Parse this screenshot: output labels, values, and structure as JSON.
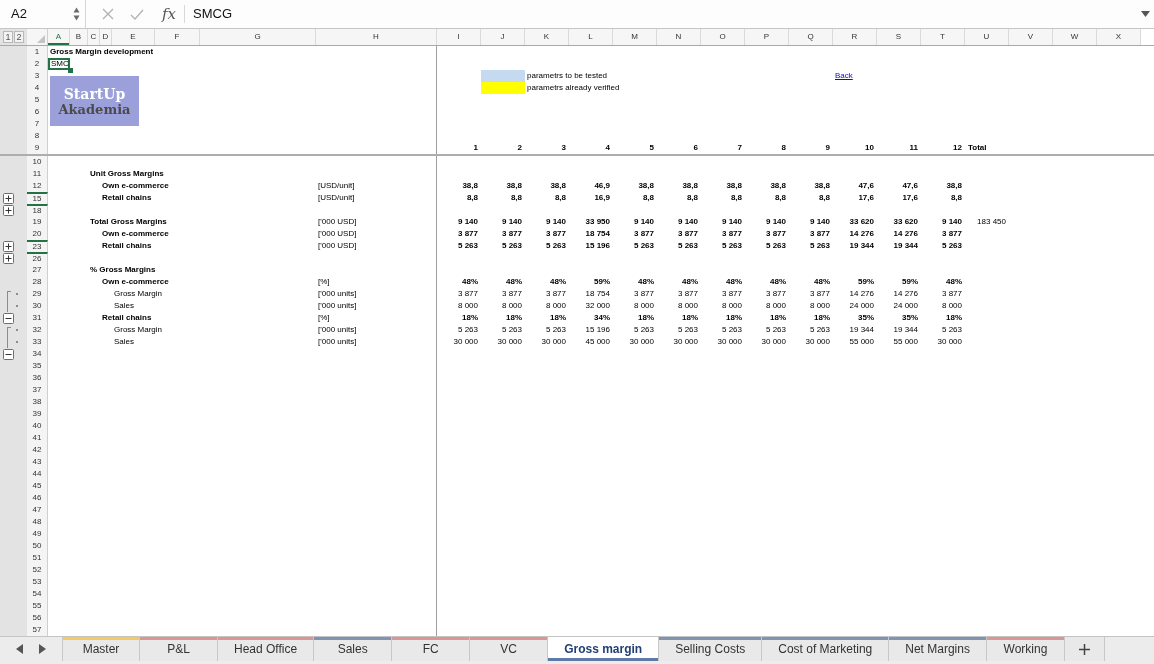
{
  "formula_bar": {
    "name_box": "A2",
    "function_label": "fx",
    "formula": "SMCG"
  },
  "outline_levels": [
    "1",
    "2"
  ],
  "columns": [
    {
      "letter": "A",
      "selected": true
    },
    {
      "letter": "B",
      "selected": false
    },
    {
      "letter": "C",
      "selected": false
    },
    {
      "letter": "D",
      "selected": false
    },
    {
      "letter": "E",
      "selected": false
    },
    {
      "letter": "F",
      "selected": false
    },
    {
      "letter": "G",
      "selected": false
    },
    {
      "letter": "H",
      "selected": false
    },
    {
      "letter": "I",
      "selected": false
    },
    {
      "letter": "J",
      "selected": false
    },
    {
      "letter": "K",
      "selected": false
    },
    {
      "letter": "L",
      "selected": false
    },
    {
      "letter": "M",
      "selected": false
    },
    {
      "letter": "N",
      "selected": false
    },
    {
      "letter": "O",
      "selected": false
    },
    {
      "letter": "P",
      "selected": false
    },
    {
      "letter": "Q",
      "selected": false
    },
    {
      "letter": "R",
      "selected": false
    },
    {
      "letter": "S",
      "selected": false
    },
    {
      "letter": "T",
      "selected": false
    },
    {
      "letter": "U",
      "selected": false
    },
    {
      "letter": "V",
      "selected": false
    },
    {
      "letter": "W",
      "selected": false
    },
    {
      "letter": "X",
      "selected": false
    }
  ],
  "logo": {
    "title": "StartUp",
    "subtitle": "Akademia"
  },
  "frozen_rows": [
    {
      "number": "1",
      "label": {
        "kind": "title",
        "text": "Gross Margin development",
        "selected": false
      }
    },
    {
      "number": "2",
      "label": {
        "kind": "plain",
        "text": "SMC",
        "selected": true
      }
    },
    {
      "number": "3",
      "legend": {
        "color": "#c5d9f1",
        "text": "parametrs to be tested"
      },
      "link": "Back"
    },
    {
      "number": "4",
      "legend": {
        "color": "#ffff00",
        "text": "parametrs already verified"
      }
    },
    {
      "number": "5"
    },
    {
      "number": "6"
    },
    {
      "number": "7"
    },
    {
      "number": "8"
    },
    {
      "number": "9",
      "header": true,
      "values": [
        "1",
        "2",
        "3",
        "4",
        "5",
        "6",
        "7",
        "8",
        "9",
        "10",
        "11",
        "12"
      ],
      "total": "Total"
    }
  ],
  "rows": [
    {
      "number": "10"
    },
    {
      "number": "11",
      "label": {
        "kind": "section",
        "text": "Unit Gross Margins",
        "selected": false
      }
    },
    {
      "number": "12",
      "label": {
        "kind": "group",
        "text": "Own e-commerce",
        "selected": false
      },
      "unit": "[USD/unit]",
      "values": [
        "38,8",
        "38,8",
        "38,8",
        "46,9",
        "38,8",
        "38,8",
        "38,8",
        "38,8",
        "38,8",
        "47,6",
        "47,6",
        "38,8"
      ]
    },
    {
      "number": "15",
      "outline": {
        "kind": "toggle",
        "expanded": false
      },
      "label": {
        "kind": "group",
        "text": "Retail chains",
        "selected": false
      },
      "unit": "[USD/unit]",
      "values": [
        "8,8",
        "8,8",
        "8,8",
        "16,9",
        "8,8",
        "8,8",
        "8,8",
        "8,8",
        "8,8",
        "17,6",
        "17,6",
        "8,8"
      ]
    },
    {
      "number": "18",
      "outline": {
        "kind": "toggle",
        "expanded": false
      }
    },
    {
      "number": "19",
      "label": {
        "kind": "section",
        "text": "Total Gross Margins",
        "selected": false
      },
      "unit": "['000 USD]",
      "values": [
        "9 140",
        "9 140",
        "9 140",
        "33 950",
        "9 140",
        "9 140",
        "9 140",
        "9 140",
        "9 140",
        "33 620",
        "33 620",
        "9 140"
      ],
      "total": "183 450"
    },
    {
      "number": "20",
      "label": {
        "kind": "group",
        "text": "Own e-commerce",
        "selected": false
      },
      "unit": "['000 USD]",
      "values": [
        "3 877",
        "3 877",
        "3 877",
        "18 754",
        "3 877",
        "3 877",
        "3 877",
        "3 877",
        "3 877",
        "14 276",
        "14 276",
        "3 877"
      ]
    },
    {
      "number": "23",
      "outline": {
        "kind": "toggle",
        "expanded": false
      },
      "label": {
        "kind": "group",
        "text": "Retail chains",
        "selected": false
      },
      "unit": "['000 USD]",
      "values": [
        "5 263",
        "5 263",
        "5 263",
        "15 196",
        "5 263",
        "5 263",
        "5 263",
        "5 263",
        "5 263",
        "19 344",
        "19 344",
        "5 263"
      ]
    },
    {
      "number": "26",
      "outline": {
        "kind": "toggle",
        "expanded": false
      }
    },
    {
      "number": "27",
      "label": {
        "kind": "section",
        "text": "% Gross Margins",
        "selected": false
      }
    },
    {
      "number": "28",
      "label": {
        "kind": "group",
        "text": "Own e-commerce",
        "selected": false
      },
      "unit": "[%]",
      "values": [
        "48%",
        "48%",
        "48%",
        "59%",
        "48%",
        "48%",
        "48%",
        "48%",
        "48%",
        "59%",
        "59%",
        "48%"
      ]
    },
    {
      "number": "29",
      "outline": {
        "kind": "member"
      },
      "label": {
        "kind": "detail",
        "text": "Gross Margin",
        "selected": false
      },
      "unit": "['000 units]",
      "values": [
        "3 877",
        "3 877",
        "3 877",
        "18 754",
        "3 877",
        "3 877",
        "3 877",
        "3 877",
        "3 877",
        "14 276",
        "14 276",
        "3 877"
      ]
    },
    {
      "number": "30",
      "outline": {
        "kind": "member"
      },
      "label": {
        "kind": "detail",
        "text": "Sales",
        "selected": false
      },
      "unit": "['000 units]",
      "values": [
        "8 000",
        "8 000",
        "8 000",
        "32 000",
        "8 000",
        "8 000",
        "8 000",
        "8 000",
        "8 000",
        "24 000",
        "24 000",
        "8 000"
      ]
    },
    {
      "number": "31",
      "outline": {
        "kind": "toggle",
        "expanded": true
      },
      "label": {
        "kind": "group",
        "text": "Retail chains",
        "selected": false
      },
      "unit": "[%]",
      "values": [
        "18%",
        "18%",
        "18%",
        "34%",
        "18%",
        "18%",
        "18%",
        "18%",
        "18%",
        "35%",
        "35%",
        "18%"
      ]
    },
    {
      "number": "32",
      "outline": {
        "kind": "member"
      },
      "label": {
        "kind": "detail",
        "text": "Gross Margin",
        "selected": false
      },
      "unit": "['000 units]",
      "values": [
        "5 263",
        "5 263",
        "5 263",
        "15 196",
        "5 263",
        "5 263",
        "5 263",
        "5 263",
        "5 263",
        "19 344",
        "19 344",
        "5 263"
      ]
    },
    {
      "number": "33",
      "outline": {
        "kind": "member"
      },
      "label": {
        "kind": "detail",
        "text": "Sales",
        "selected": false
      },
      "unit": "['000 units]",
      "values": [
        "30 000",
        "30 000",
        "30 000",
        "45 000",
        "30 000",
        "30 000",
        "30 000",
        "30 000",
        "30 000",
        "55 000",
        "55 000",
        "30 000"
      ]
    },
    {
      "number": "34",
      "outline": {
        "kind": "toggle",
        "expanded": true
      }
    },
    {
      "number": "35"
    },
    {
      "number": "36"
    },
    {
      "number": "37"
    },
    {
      "number": "38"
    },
    {
      "number": "39"
    },
    {
      "number": "40"
    },
    {
      "number": "41"
    },
    {
      "number": "42"
    },
    {
      "number": "43"
    },
    {
      "number": "44"
    },
    {
      "number": "45"
    },
    {
      "number": "46"
    },
    {
      "number": "47"
    },
    {
      "number": "48"
    },
    {
      "number": "49"
    },
    {
      "number": "50"
    },
    {
      "number": "51"
    },
    {
      "number": "52"
    },
    {
      "number": "53"
    },
    {
      "number": "54"
    },
    {
      "number": "55"
    },
    {
      "number": "56"
    },
    {
      "number": "57"
    }
  ],
  "sheet_tabs": [
    {
      "label": "Master",
      "color": "#f4c95d",
      "selected": false
    },
    {
      "label": "P&L",
      "color": "#da9694",
      "selected": false
    },
    {
      "label": "Head Office",
      "color": "#da9694",
      "selected": false
    },
    {
      "label": "Sales",
      "color": "#8093b3",
      "selected": false
    },
    {
      "label": "FC",
      "color": "#da9694",
      "selected": false
    },
    {
      "label": "VC",
      "color": "#da9694",
      "selected": false
    },
    {
      "label": "Gross margin",
      "color": "#5f7aa6",
      "selected": true
    },
    {
      "label": "Selling Costs",
      "color": "#8093b3",
      "selected": false
    },
    {
      "label": "Cost of Marketing",
      "color": "#8093b3",
      "selected": false
    },
    {
      "label": "Net Margins",
      "color": "#8093b3",
      "selected": false
    },
    {
      "label": "Working",
      "color": "#da9694",
      "selected": false
    }
  ]
}
